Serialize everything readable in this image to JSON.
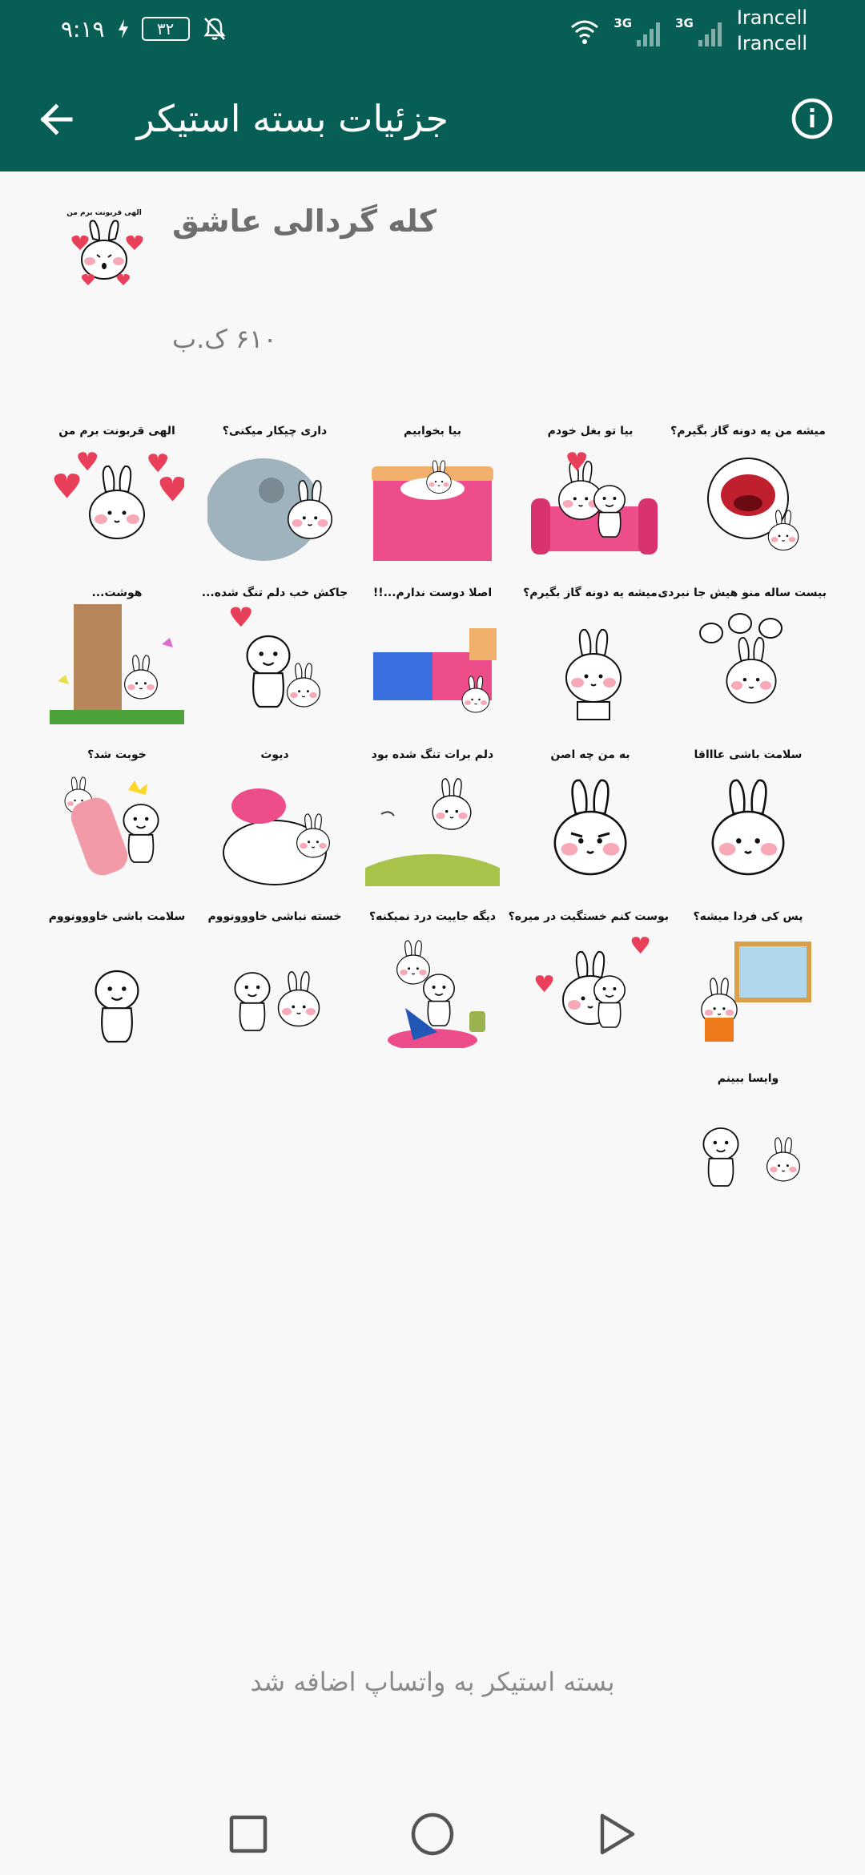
{
  "status_bar": {
    "time": "۹:۱۹",
    "battery": "۳۲",
    "network_type_1": "3G",
    "network_type_2": "3G",
    "carrier_1": "Irancell",
    "carrier_2": "Irancell"
  },
  "app_bar": {
    "title": "جزئیات بسته استیکر"
  },
  "pack": {
    "name": "کله گردالی عاشق",
    "size": "۶۱۰ ک.ب",
    "tray_caption": "الهی قربونت برم من"
  },
  "stickers": [
    {
      "caption": "میشه من یه دونه گاز بگیرم؟",
      "scene": "mouth"
    },
    {
      "caption": "بیا تو بغل خودم",
      "scene": "couch"
    },
    {
      "caption": "بیا بخوابیم",
      "scene": "bed"
    },
    {
      "caption": "داری چیکار میکنی؟",
      "scene": "peek"
    },
    {
      "caption": "الهی قربونت برم من",
      "scene": "hearts"
    },
    {
      "caption": "بیست ساله منو هیش جا نبردی",
      "scene": "tantrum"
    },
    {
      "caption": "میشه یه دونه گاز بگیرم؟",
      "scene": "shy"
    },
    {
      "caption": "اصلا دوست ندارم...!!",
      "scene": "beds"
    },
    {
      "caption": "جاکش خب دلم تنگ شده...",
      "scene": "hug"
    },
    {
      "caption": "هوشت...",
      "scene": "tree"
    },
    {
      "caption": "سلامت باشی عاااقا",
      "scene": "face"
    },
    {
      "caption": "به من چه اصن",
      "scene": "grumpy"
    },
    {
      "caption": "دلم برات تنگ شده بود",
      "scene": "field"
    },
    {
      "caption": "دیوث",
      "scene": "crush"
    },
    {
      "caption": "خوبت شد؟",
      "scene": "hit"
    },
    {
      "caption": "پس کی فردا میشه؟",
      "scene": "frame"
    },
    {
      "caption": "بوست کنم خستگیت در میره؟",
      "scene": "kiss"
    },
    {
      "caption": "دیگه جاییت درد نمیکنه؟",
      "scene": "care"
    },
    {
      "caption": "خسته نباشی خاووونووم",
      "scene": "duo"
    },
    {
      "caption": "سلامت باشی خاووونووم",
      "scene": "single"
    },
    {
      "caption": "وایسا ببینم",
      "scene": "stop"
    }
  ],
  "footer": {
    "status": "بسته استیکر به واتساپ اضافه شد"
  },
  "colors": {
    "primary": "#075e54",
    "background": "#f8f8f8",
    "cheek": "#f7a9b8",
    "heart": "#e8405a"
  }
}
